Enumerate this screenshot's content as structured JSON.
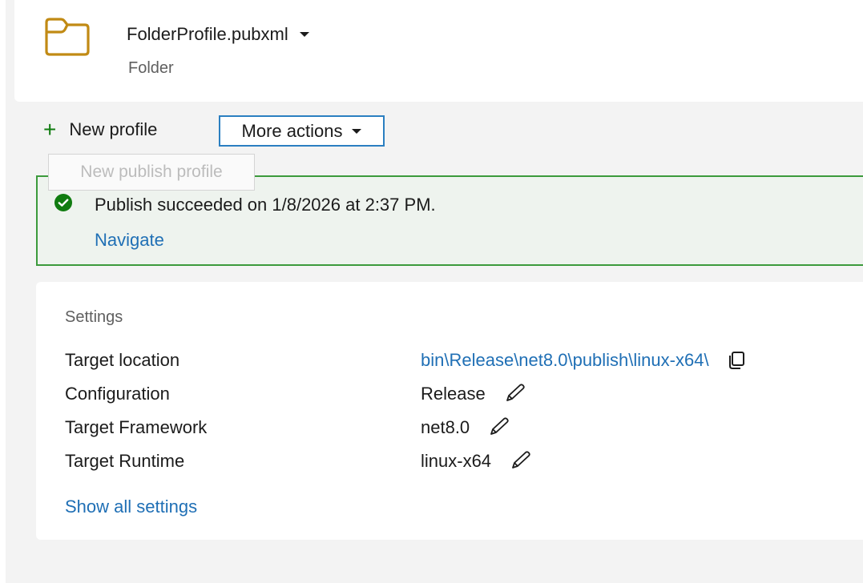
{
  "header": {
    "profile_name": "FolderProfile.pubxml",
    "profile_type": "Folder",
    "icon": "folder-icon"
  },
  "actions": {
    "new_profile_label": "New profile",
    "more_actions_label": "More actions",
    "tooltip": "New publish profile"
  },
  "banner": {
    "message": "Publish succeeded on 1/8/2026 at 2:37 PM.",
    "link_label": "Navigate",
    "status_color": "#107c10"
  },
  "settings": {
    "title": "Settings",
    "rows": [
      {
        "label": "Target location",
        "value": "bin\\Release\\net8.0\\publish\\linux-x64\\",
        "action_icon": "copy-icon"
      },
      {
        "label": "Configuration",
        "value": "Release",
        "action_icon": "edit-icon"
      },
      {
        "label": "Target Framework",
        "value": "net8.0",
        "action_icon": "edit-icon"
      },
      {
        "label": "Target Runtime",
        "value": "linux-x64",
        "action_icon": "edit-icon"
      }
    ],
    "show_all_label": "Show all settings"
  },
  "colors": {
    "accent_link": "#1f6fb5",
    "success_border": "#3c9a3c",
    "folder_icon": "#c18a14",
    "focus_border": "#2b7fc1"
  }
}
